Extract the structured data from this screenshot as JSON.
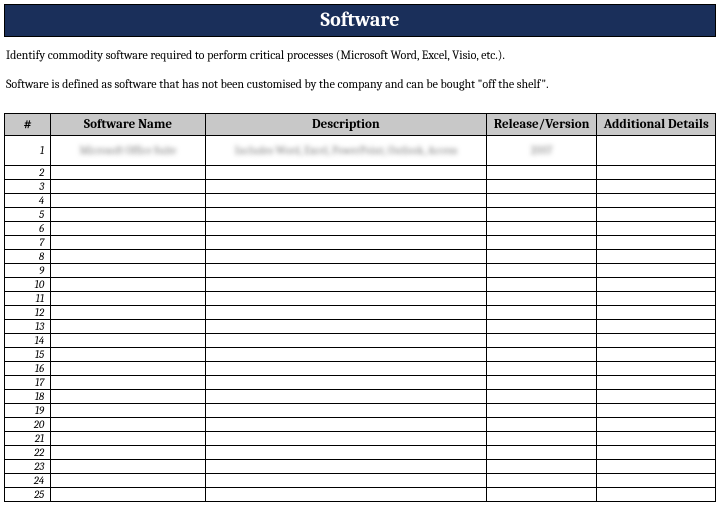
{
  "header": {
    "title": "Software"
  },
  "intro": {
    "line1": "Identify commodity software required to perform critical processes (Microsoft Word, Excel, Visio, etc.).",
    "line2": "Software is defined as software that has not been customised by the company and can be bought \"off the shelf\"."
  },
  "columns": {
    "num": "#",
    "name": "Software Name",
    "desc": "Description",
    "rel": "Release/Version",
    "add": "Additional Details"
  },
  "rows": [
    {
      "num": "1",
      "name": "Microsoft Office Suite",
      "desc": "Includes Word, Excel, PowerPoint, Outlook, Access",
      "rel": "2007",
      "add": ""
    },
    {
      "num": "2",
      "name": "",
      "desc": "",
      "rel": "",
      "add": ""
    },
    {
      "num": "3",
      "name": "",
      "desc": "",
      "rel": "",
      "add": ""
    },
    {
      "num": "4",
      "name": "",
      "desc": "",
      "rel": "",
      "add": ""
    },
    {
      "num": "5",
      "name": "",
      "desc": "",
      "rel": "",
      "add": ""
    },
    {
      "num": "6",
      "name": "",
      "desc": "",
      "rel": "",
      "add": ""
    },
    {
      "num": "7",
      "name": "",
      "desc": "",
      "rel": "",
      "add": ""
    },
    {
      "num": "8",
      "name": "",
      "desc": "",
      "rel": "",
      "add": ""
    },
    {
      "num": "9",
      "name": "",
      "desc": "",
      "rel": "",
      "add": ""
    },
    {
      "num": "10",
      "name": "",
      "desc": "",
      "rel": "",
      "add": ""
    },
    {
      "num": "11",
      "name": "",
      "desc": "",
      "rel": "",
      "add": ""
    },
    {
      "num": "12",
      "name": "",
      "desc": "",
      "rel": "",
      "add": ""
    },
    {
      "num": "13",
      "name": "",
      "desc": "",
      "rel": "",
      "add": ""
    },
    {
      "num": "14",
      "name": "",
      "desc": "",
      "rel": "",
      "add": ""
    },
    {
      "num": "15",
      "name": "",
      "desc": "",
      "rel": "",
      "add": ""
    },
    {
      "num": "16",
      "name": "",
      "desc": "",
      "rel": "",
      "add": ""
    },
    {
      "num": "17",
      "name": "",
      "desc": "",
      "rel": "",
      "add": ""
    },
    {
      "num": "18",
      "name": "",
      "desc": "",
      "rel": "",
      "add": ""
    },
    {
      "num": "19",
      "name": "",
      "desc": "",
      "rel": "",
      "add": ""
    },
    {
      "num": "20",
      "name": "",
      "desc": "",
      "rel": "",
      "add": ""
    },
    {
      "num": "21",
      "name": "",
      "desc": "",
      "rel": "",
      "add": ""
    },
    {
      "num": "22",
      "name": "",
      "desc": "",
      "rel": "",
      "add": ""
    },
    {
      "num": "23",
      "name": "",
      "desc": "",
      "rel": "",
      "add": ""
    },
    {
      "num": "24",
      "name": "",
      "desc": "",
      "rel": "",
      "add": ""
    },
    {
      "num": "25",
      "name": "",
      "desc": "",
      "rel": "",
      "add": ""
    }
  ]
}
